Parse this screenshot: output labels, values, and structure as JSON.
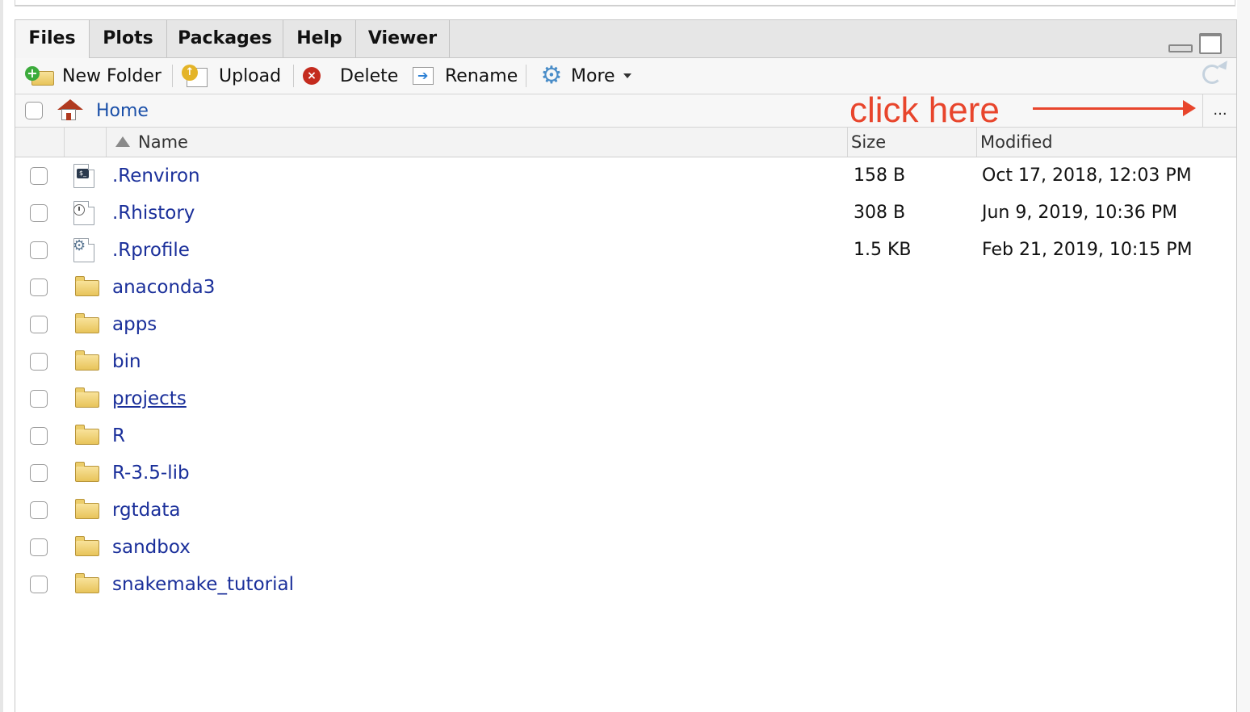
{
  "tabs": [
    {
      "label": "Files",
      "active": true
    },
    {
      "label": "Plots",
      "active": false
    },
    {
      "label": "Packages",
      "active": false
    },
    {
      "label": "Help",
      "active": false
    },
    {
      "label": "Viewer",
      "active": false
    }
  ],
  "toolbar": {
    "new_folder": "New Folder",
    "upload": "Upload",
    "delete": "Delete",
    "rename": "Rename",
    "more": "More"
  },
  "path": {
    "home": "Home",
    "more_label": "...",
    "annotation": "click here"
  },
  "columns": {
    "name": "Name",
    "size": "Size",
    "modified": "Modified"
  },
  "files": [
    {
      "name": ".Renviron",
      "size": "158 B",
      "modified": "Oct 17, 2018, 12:03 PM",
      "icon": "terminal-file-icon"
    },
    {
      "name": ".Rhistory",
      "size": "308 B",
      "modified": "Jun 9, 2019, 10:36 PM",
      "icon": "history-file-icon"
    },
    {
      "name": ".Rprofile",
      "size": "1.5 KB",
      "modified": "Feb 21, 2019, 10:15 PM",
      "icon": "settings-file-icon"
    },
    {
      "name": "anaconda3",
      "size": "",
      "modified": "",
      "icon": "folder-icon"
    },
    {
      "name": "apps",
      "size": "",
      "modified": "",
      "icon": "folder-icon"
    },
    {
      "name": "bin",
      "size": "",
      "modified": "",
      "icon": "folder-icon"
    },
    {
      "name": "projects",
      "size": "",
      "modified": "",
      "icon": "folder-icon"
    },
    {
      "name": "R",
      "size": "",
      "modified": "",
      "icon": "folder-icon"
    },
    {
      "name": "R-3.5-lib",
      "size": "",
      "modified": "",
      "icon": "folder-icon"
    },
    {
      "name": "rgtdata",
      "size": "",
      "modified": "",
      "icon": "folder-icon"
    },
    {
      "name": "sandbox",
      "size": "",
      "modified": "",
      "icon": "folder-icon"
    },
    {
      "name": "snakemake_tutorial",
      "size": "",
      "modified": "",
      "icon": "folder-icon"
    }
  ],
  "colors": {
    "link": "#1a2f9a",
    "annotation": "#e8452c",
    "home_link": "#1a4fa8"
  }
}
